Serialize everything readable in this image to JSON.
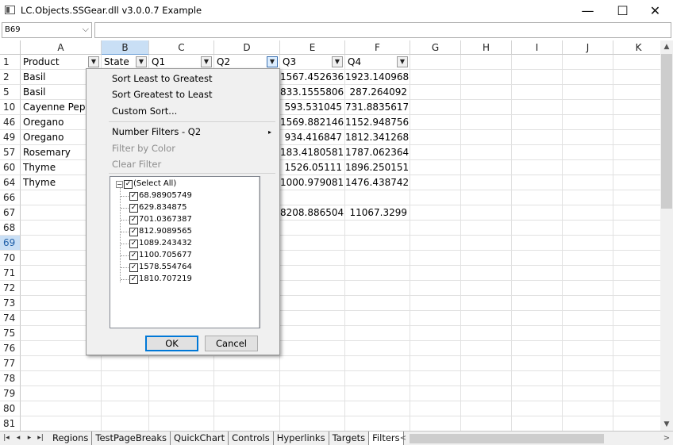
{
  "window": {
    "title": "LC.Objects.SSGear.dll v3.0.0.7 Example",
    "minimize": "—",
    "maximize": "☐",
    "close": "✕"
  },
  "namebox": {
    "value": "B69",
    "arrow": "⌵"
  },
  "columns": [
    "A",
    "B",
    "C",
    "D",
    "E",
    "F",
    "G",
    "H",
    "I",
    "J",
    "K"
  ],
  "rows": [
    "1",
    "2",
    "5",
    "10",
    "46",
    "49",
    "57",
    "60",
    "64",
    "66",
    "67",
    "68",
    "69",
    "70",
    "71",
    "72",
    "73",
    "74",
    "75",
    "76",
    "77",
    "78",
    "79",
    "80",
    "81"
  ],
  "cells": {
    "A": [
      "Product",
      "Basil",
      "Basil",
      "Cayenne Pepp",
      "Oregano",
      "Oregano",
      "Rosemary",
      "Thyme",
      "Thyme",
      "",
      ""
    ],
    "B": [
      "State"
    ],
    "C": [
      "Q1"
    ],
    "D": [
      "Q2"
    ],
    "E": [
      "Q3",
      "1567.452636",
      "833.1555806",
      "593.531045",
      "1569.882146",
      "934.416847",
      "183.4180581",
      "1526.05111",
      "1000.979081",
      "",
      "8208.886504"
    ],
    "F": [
      "Q4",
      "1923.140968",
      "287.264092",
      "731.8835617",
      "1152.948756",
      "1812.341268",
      "1787.062364",
      "1896.250151",
      "1476.438742",
      "",
      "11067.3299"
    ]
  },
  "filter_menu": {
    "items": [
      "Sort Least to Greatest",
      "Sort Greatest to Least",
      "Custom Sort...",
      "Number Filters - Q2",
      "Filter by Color",
      "Clear Filter"
    ],
    "submenu_arrow": "▸",
    "select_all": "(Select All)",
    "values": [
      "68.98905749",
      "629.834875",
      "701.0367387",
      "812.9089565",
      "1089.243432",
      "1100.705677",
      "1578.554764",
      "1810.707219"
    ],
    "ok": "OK",
    "cancel": "Cancel"
  },
  "tabs": [
    "Regions",
    "TestPageBreaks",
    "QuickChart",
    "Controls",
    "Hyperlinks",
    "Targets",
    "Filters"
  ],
  "icons": {
    "check": "✓",
    "minus": "−",
    "dropdown": "▼",
    "filtered": "▼"
  }
}
